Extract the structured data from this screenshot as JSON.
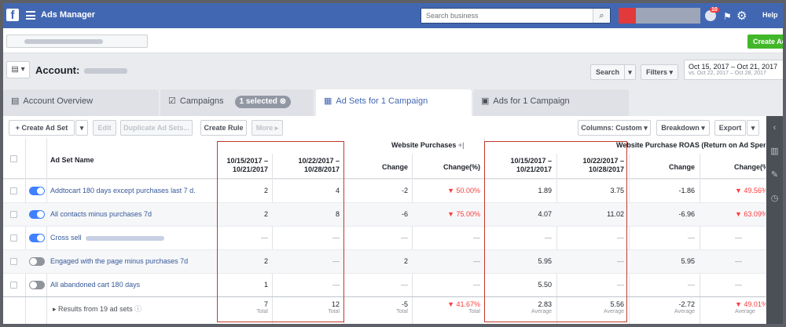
{
  "topbar": {
    "logo": "f",
    "title": "Ads Manager",
    "search_placeholder": "Search business",
    "notif_count": "10",
    "help_label": "Help"
  },
  "subbar": {
    "create_ad_label": "Create Ad"
  },
  "account": {
    "label": "Account:",
    "search_label": "Search",
    "filters_label": "Filters",
    "date_range": "Oct 15, 2017 – Oct 21, 2017",
    "compare_range": "vs. Oct 22, 2017 – Oct 28, 2017"
  },
  "tabs": [
    {
      "label": "Account Overview",
      "icon": "overview-icon"
    },
    {
      "label": "Campaigns",
      "icon": "campaign-icon",
      "pill": "1 selected"
    },
    {
      "label": "Ad Sets for 1 Campaign",
      "icon": "adsets-icon"
    },
    {
      "label": "Ads for 1 Campaign",
      "icon": "ads-icon"
    }
  ],
  "toolbar": {
    "create_label": "Create Ad Set",
    "edit_label": "Edit",
    "duplicate_label": "Duplicate Ad Sets...",
    "create_rule_label": "Create Rule",
    "more_label": "More",
    "columns_label": "Columns: Custom",
    "breakdown_label": "Breakdown",
    "export_label": "Export"
  },
  "table": {
    "name_header": "Ad Set Name",
    "group1": "Website Purchases",
    "group2": "Website Purchase ROAS (Return on Ad Spend)",
    "headers": {
      "p1": "10/15/2017 – 10/21/2017",
      "p2": "10/22/2017 – 10/28/2017",
      "change": "Change",
      "change_pct": "Change(%)"
    },
    "rows": [
      {
        "name": "Addtocart 180 days except purchases last 7 d.",
        "active": true,
        "wp1": "2",
        "wp2": "4",
        "wpc": "-2",
        "wpp": "▼ 50.00%",
        "r1": "1.89",
        "r2": "3.75",
        "rc": "-1.86",
        "rp": "▼ 49.56%"
      },
      {
        "name": "All contacts minus purchases 7d",
        "active": true,
        "wp1": "2",
        "wp2": "8",
        "wpc": "-6",
        "wpp": "▼ 75.00%",
        "r1": "4.07",
        "r2": "11.02",
        "rc": "-6.96",
        "rp": "▼ 63.09%"
      },
      {
        "name": "Cross sell",
        "active": true,
        "wp1": "—",
        "wp2": "—",
        "wpc": "—",
        "wpp": "—",
        "r1": "—",
        "r2": "—",
        "rc": "—",
        "rp": "—"
      },
      {
        "name": "Engaged with the page minus purchases 7d",
        "active": false,
        "wp1": "2",
        "wp2": "—",
        "wpc": "2",
        "wpp": "—",
        "r1": "5.95",
        "r2": "—",
        "rc": "5.95",
        "rp": "—"
      },
      {
        "name": "All abandoned cart 180 days",
        "active": false,
        "wp1": "1",
        "wp2": "—",
        "wpc": "—",
        "wpp": "—",
        "r1": "5.50",
        "r2": "—",
        "rc": "—",
        "rp": "—"
      }
    ],
    "summary": {
      "label": "Results from 19 ad sets",
      "wp1": "7",
      "wp2": "12",
      "wpc": "-5",
      "wpp": "▼ 41.67%",
      "r1": "2.83",
      "r2": "5.56",
      "rc": "-2.72",
      "rp": "▼ 49.01%",
      "total": "Total",
      "average": "Average"
    }
  },
  "colors": {
    "brand": "#4267b2",
    "negative": "#fa3e3e",
    "toggle_on": "#4080ff",
    "highlight": "#c0392b"
  }
}
